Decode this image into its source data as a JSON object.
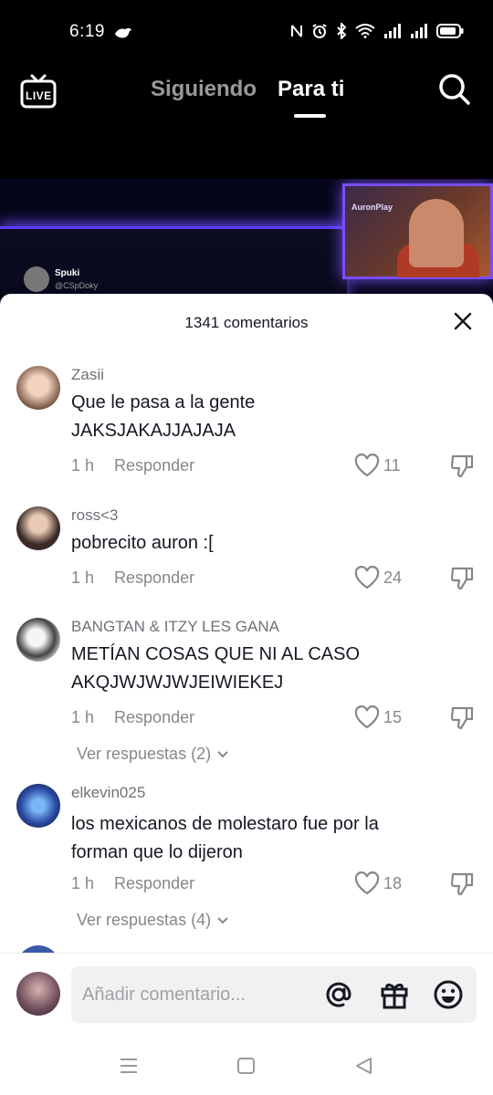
{
  "status_bar": {
    "time": "6:19"
  },
  "top_nav": {
    "live_label": "LIVE",
    "tabs": [
      {
        "label": "Siguiendo",
        "active": false
      },
      {
        "label": "Para ti",
        "active": true
      }
    ]
  },
  "video": {
    "tweet_name": "Spuki",
    "tweet_handle": "@CSpDoky",
    "cam_label": "AuronPlay"
  },
  "comments_sheet": {
    "title": "1341 comentarios",
    "comments": [
      {
        "user": "Zasii",
        "text": "Que le pasa a la gente JAKSJAKAJJAJAJA",
        "time": "1 h",
        "reply_label": "Responder",
        "likes": "11"
      },
      {
        "user": "ross<3",
        "text": "pobrecito auron :[",
        "time": "1 h",
        "reply_label": "Responder",
        "likes": "24"
      },
      {
        "user": "BANGTAN & ITZY LES GANA",
        "text": "METÍAN COSAS QUE NI AL CASO AKQJWJWJWJEIWIEKEJ",
        "time": "1 h",
        "reply_label": "Responder",
        "likes": "15",
        "replies": "Ver respuestas (2)"
      },
      {
        "user": "elkevin025",
        "text": "los mexicanos de molestaro fue por la forman que lo dijeron",
        "time": "1 h",
        "reply_label": "Responder",
        "likes": "18",
        "replies": "Ver respuestas (4)"
      }
    ],
    "input_placeholder": "Añadir comentario..."
  }
}
